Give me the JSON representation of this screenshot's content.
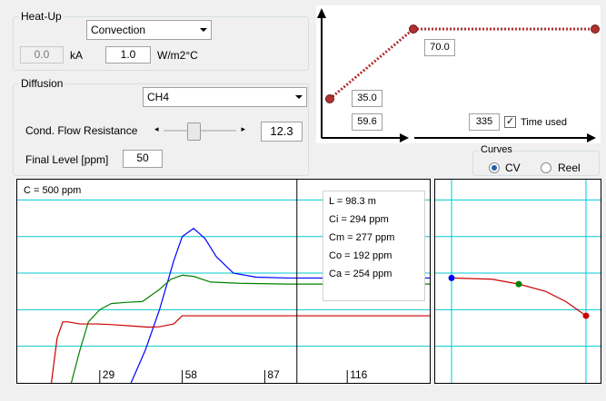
{
  "heatup": {
    "title": "Heat-Up",
    "mode": "Convection",
    "kA_value": "0.0",
    "kA_unit": "kA",
    "h_value": "1.0",
    "h_unit": "W/m2°C"
  },
  "diffusion": {
    "title": "Diffusion",
    "gas": "CH4",
    "flow_label": "Cond. Flow Resistance",
    "flow_value": "12.3",
    "slider_fraction": 0.4,
    "final_label": "Final Level [ppm]",
    "final_value": "50"
  },
  "profile": {
    "start_value": "35.0",
    "end_value": "70.0",
    "ramp_time": "59.6",
    "total_time": "335",
    "time_used_label": "Time used",
    "time_used_checked": true
  },
  "curves": {
    "title": "Curves",
    "options": [
      "CV",
      "Reel"
    ],
    "selected": "CV"
  },
  "main_chart": {
    "header": "C = 500 ppm",
    "tooltip": [
      "L = 98.3 m",
      "Ci = 294 ppm",
      "Cm = 277 ppm",
      "Co = 192 ppm",
      "Ca = 254 ppm"
    ]
  },
  "chart_data": [
    {
      "type": "line",
      "title": "C = 500 ppm",
      "xlim": [
        0,
        145
      ],
      "ylim": [
        0,
        500
      ],
      "x_ticks": [
        "29",
        "58",
        "87",
        "116"
      ],
      "x_tick_values": [
        29,
        58,
        87,
        116
      ],
      "y_grid_values": [
        90,
        180,
        270,
        360,
        450
      ],
      "cursor_x": 98.3,
      "colors": [
        "#0000ff",
        "#008000",
        "#cc0000"
      ],
      "series": [
        {
          "color": "#0000ff",
          "x": [
            40,
            45,
            50,
            55,
            58,
            62,
            66,
            70,
            76,
            84,
            95,
            145
          ],
          "y": [
            0,
            80,
            180,
            300,
            360,
            380,
            355,
            310,
            270,
            260,
            258,
            258
          ]
        },
        {
          "color": "#008000",
          "x": [
            19,
            22,
            25,
            29,
            33,
            38,
            44,
            50,
            54,
            58,
            62,
            68,
            78,
            95,
            145
          ],
          "y": [
            0,
            80,
            150,
            180,
            195,
            198,
            200,
            230,
            255,
            265,
            262,
            248,
            245,
            243,
            243
          ]
        },
        {
          "color": "#cc0000",
          "x": [
            12,
            14,
            16,
            18,
            22,
            28,
            34,
            40,
            46,
            50,
            55,
            58,
            70,
            100,
            145
          ],
          "y": [
            0,
            110,
            150,
            150,
            145,
            145,
            143,
            140,
            137,
            138,
            145,
            165,
            165,
            165,
            165
          ]
        }
      ]
    },
    {
      "type": "line",
      "xlim": [
        0,
        1
      ],
      "ylim": [
        0,
        500
      ],
      "y_grid_values": [
        90,
        180,
        270,
        360,
        450
      ],
      "series": [
        {
          "color": "#cc0000",
          "x": [
            0.0,
            0.3,
            0.5,
            0.7,
            0.85,
            1.0
          ],
          "y": [
            258,
            255,
            243,
            225,
            200,
            165
          ]
        }
      ],
      "markers": [
        {
          "x": 0.0,
          "y": 258,
          "color": "#0000ff"
        },
        {
          "x": 0.5,
          "y": 243,
          "color": "#008000"
        },
        {
          "x": 1.0,
          "y": 165,
          "color": "#cc0000"
        }
      ]
    }
  ]
}
